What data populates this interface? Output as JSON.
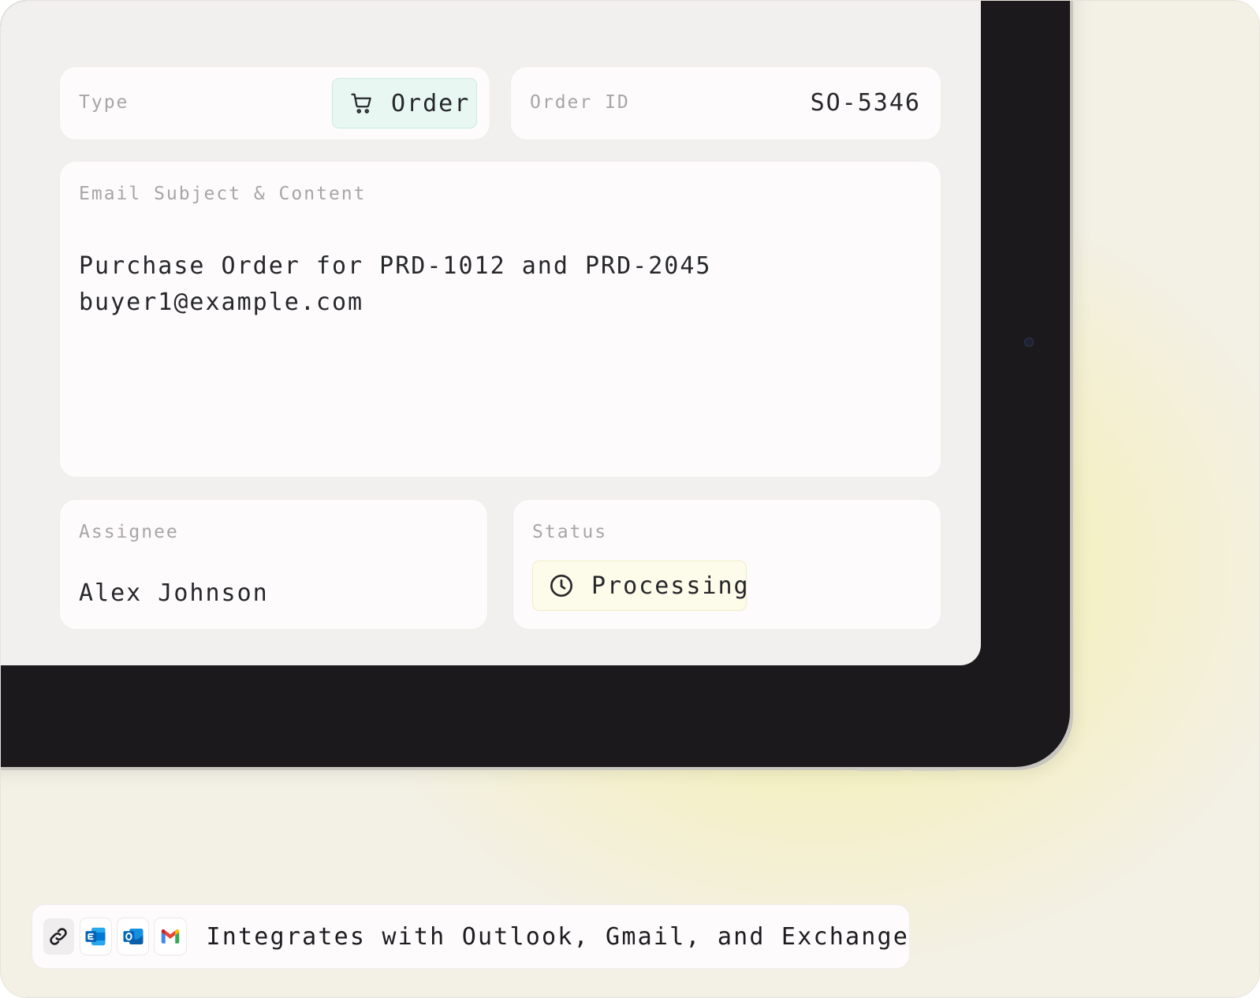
{
  "type_card": {
    "label": "Type",
    "chip_icon": "shopping-cart-icon",
    "chip_label": "Order"
  },
  "order_id_card": {
    "label": "Order ID",
    "value": "SO-5346"
  },
  "email_card": {
    "label": "Email Subject & Content",
    "subject": "Purchase Order for PRD-1012 and PRD-2045",
    "sender": "buyer1@example.com"
  },
  "assignee_card": {
    "label": "Assignee",
    "value": "Alex Johnson"
  },
  "status_card": {
    "label": "Status",
    "chip_icon": "clock-icon",
    "chip_label": "Processing"
  },
  "integrations": {
    "icons": [
      "link-icon",
      "exchange-icon",
      "outlook-icon",
      "gmail-icon"
    ],
    "text": "Integrates with Outlook, Gmail, and Exchange"
  },
  "colors": {
    "order_chip_bg": "#e8f7f1",
    "status_chip_bg": "#fdfbe9",
    "device_frame": "#1b191c",
    "glow": "#f5f1a9"
  }
}
